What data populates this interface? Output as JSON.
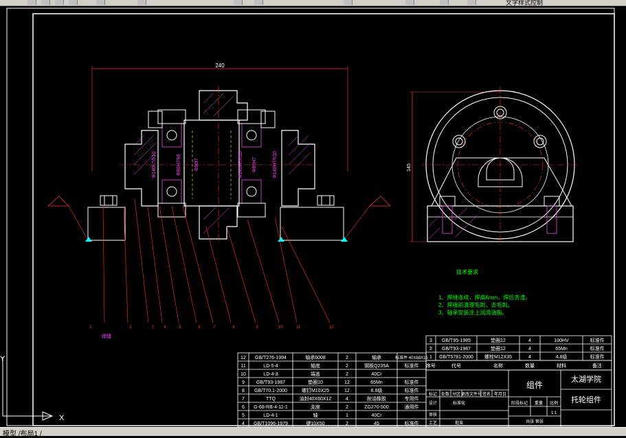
{
  "window": {
    "toolbar_label": "文字样式控制",
    "model_tabs": "模型 /布局1 /"
  },
  "drawing": {
    "dim_width": "240",
    "dim_height": "145",
    "ucs_x": "X",
    "ucs_y": "Y",
    "callouts": [
      "1",
      "2",
      "3",
      "4",
      "5",
      "6",
      "7",
      "8",
      "9",
      "10",
      "11",
      "12"
    ],
    "bottom_label": "焊缝",
    "fit_labels": [
      "Φ140h7/h10",
      "Φ80H7/k6",
      "Φ90f7",
      "Φ140H7/h10",
      "Φ80H7",
      "Φ140H7/h10"
    ],
    "tech_req": {
      "title": "技术要求",
      "items": [
        "1、焊缝连续，焊高6mm，焊后去渣。",
        "2、焊接前清理毛刺，去毛刺。",
        "3、轴承安装涂上润滑油脂。"
      ]
    }
  },
  "bom_top": [
    {
      "no": "3",
      "code": "GB/T95-1985",
      "name": "垫圈12",
      "qty": "4",
      "mat": "100HV",
      "note": "标准件"
    },
    {
      "no": "2",
      "code": "GB/T93-1987",
      "name": "垫圈12",
      "qty": "4",
      "mat": "65Mn",
      "note": "标准件"
    },
    {
      "no": "1",
      "code": "GB/T5781-2000",
      "name": "螺栓M12X35",
      "qty": "4",
      "mat": "4.8级",
      "note": "标准件"
    }
  ],
  "bom_header": {
    "no": "序号",
    "code": "代号",
    "name": "名称",
    "qty": "数量",
    "mat": "材料",
    "note": "备注"
  },
  "bom_left": [
    {
      "no": "12",
      "code": "GB/T276-1994",
      "name": "轴承6008",
      "qty": "2",
      "mat": "轴承",
      "spec": "标准件 40X68X15"
    },
    {
      "no": "11",
      "code": "LD-5-4",
      "name": "轴底",
      "qty": "2",
      "mat": "钢板Q235A",
      "spec": "标准件"
    },
    {
      "no": "10",
      "code": "LD-4-3",
      "name": "端盖",
      "qty": "2",
      "mat": "40Cr",
      "spec": ""
    },
    {
      "no": "9",
      "code": "GB/T93-1987",
      "name": "垫圈10",
      "qty": "12",
      "mat": "65Mn",
      "spec": "标准件"
    },
    {
      "no": "8",
      "code": "GB/T70.1-2000",
      "name": "螺钉M10X25",
      "qty": "12",
      "mat": "8.8级",
      "spec": "标准件"
    },
    {
      "no": "7",
      "code": "TTQ",
      "name": "油封40X60X12",
      "qty": "4",
      "mat": "耐油橡胶",
      "spec": "专用件"
    },
    {
      "no": "6",
      "code": "G-68-RB-4-11-1",
      "name": "支座",
      "qty": "2",
      "mat": "ZG270-500",
      "spec": "通用件"
    },
    {
      "no": "5",
      "code": "LD-4-1",
      "name": "轴",
      "qty": "1",
      "mat": "40Cr",
      "spec": ""
    },
    {
      "no": "4",
      "code": "GB/T1096-1979",
      "name": "键10X50",
      "qty": "2",
      "mat": "45",
      "spec": "标准件"
    }
  ],
  "title_block": {
    "part_name": "组件",
    "school": "太湖学院",
    "drawing_name": "托轮组件",
    "rows": [
      "标记",
      "处数",
      "分区",
      "更改文件号",
      "签名",
      "年月日"
    ],
    "roles": [
      "设计",
      "审核",
      "工艺",
      "批准"
    ],
    "std": "标准化",
    "stage": "阶段标记",
    "weight": "重量",
    "scale": "比例",
    "scale_val": "1:1",
    "sheet": "共张 第张"
  }
}
